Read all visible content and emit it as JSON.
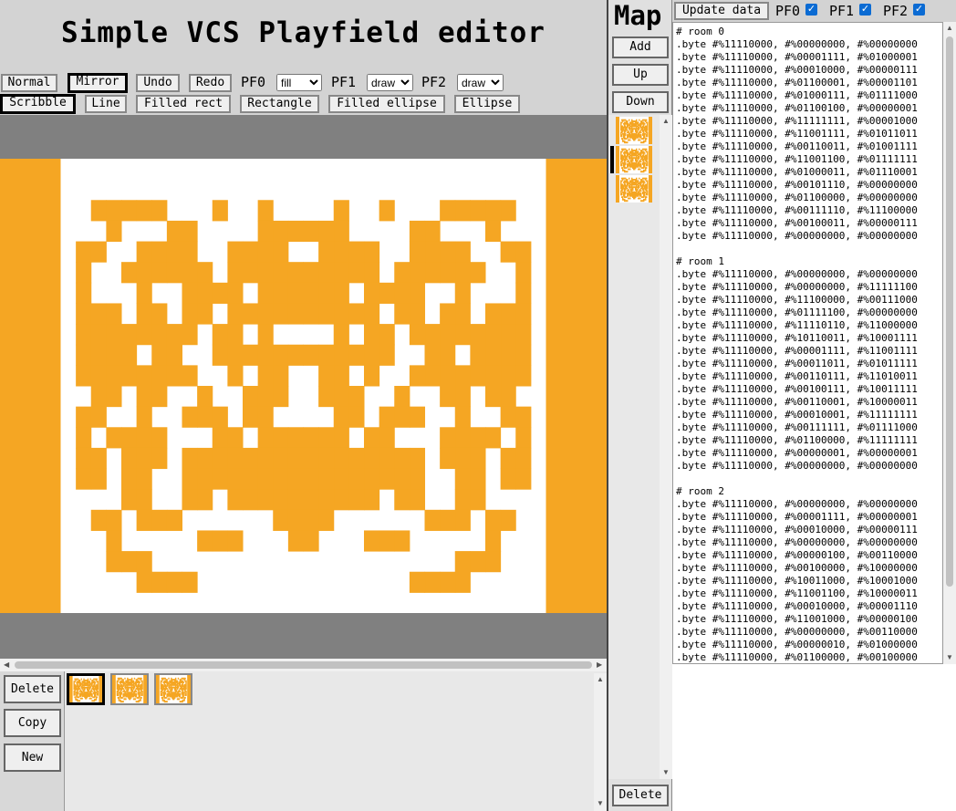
{
  "title": "Simple VCS Playfield editor",
  "colors": {
    "fg": "#f5a623",
    "bg": "#ffffff",
    "canvas_bg": "#808080"
  },
  "toolbar": {
    "normal": "Normal",
    "mirror": "Mirror",
    "undo": "Undo",
    "redo": "Redo",
    "pf0_label": "PF0",
    "pf0_value": "fill",
    "pf1_label": "PF1",
    "pf1_value": "draw",
    "pf2_label": "PF2",
    "pf2_value": "draw",
    "scribble": "Scribble",
    "line": "Line",
    "filled_rect": "Filled rect",
    "rectangle": "Rectangle",
    "filled_ellipse": "Filled ellipse",
    "ellipse": "Ellipse"
  },
  "side": {
    "delete": "Delete",
    "copy": "Copy",
    "new": "New"
  },
  "map": {
    "title": "Map",
    "add": "Add",
    "up": "Up",
    "down": "Down",
    "delete": "Delete"
  },
  "right": {
    "update": "Update data",
    "pf0": "PF0",
    "pf1": "PF1",
    "pf2": "PF2",
    "pf0_checked": true,
    "pf1_checked": true,
    "pf2_checked": true
  },
  "playfield_rows": [
    "0000000000000000",
    "0000000000000000",
    "0011111000100100",
    "0001000110000111",
    "0110011110011110",
    "0100111111011111",
    "0100010011110111",
    "0111011011011111",
    "0111111110110100",
    "0111101100111111",
    "0111111110010110",
    "0011011001001110",
    "0110010011101100",
    "0101111000110111",
    "0110111011111111",
    "0110110011111111",
    "0000110011011111",
    "0011011100000011",
    "0001000001110001",
    "0001110000000000",
    "0000011110000000",
    "0000000000000000"
  ],
  "code_lines": [
    "# room 0",
    ".byte #%11110000, #%00000000, #%00000000",
    ".byte #%11110000, #%00001111, #%01000001",
    ".byte #%11110000, #%00010000, #%00000111",
    ".byte #%11110000, #%01100001, #%00001101",
    ".byte #%11110000, #%01000111, #%01111000",
    ".byte #%11110000, #%01100100, #%00000001",
    ".byte #%11110000, #%11111111, #%00001000",
    ".byte #%11110000, #%11001111, #%01011011",
    ".byte #%11110000, #%00110011, #%01001111",
    ".byte #%11110000, #%11001100, #%01111111",
    ".byte #%11110000, #%01000011, #%01110001",
    ".byte #%11110000, #%00101110, #%00000000",
    ".byte #%11110000, #%01100000, #%00000000",
    ".byte #%11110000, #%00111110, #%11100000",
    ".byte #%11110000, #%00100011, #%00000111",
    ".byte #%11110000, #%00000000, #%00000000",
    "",
    "# room 1",
    ".byte #%11110000, #%00000000, #%00000000",
    ".byte #%11110000, #%00000000, #%11111100",
    ".byte #%11110000, #%11100000, #%00111000",
    ".byte #%11110000, #%01111100, #%00000000",
    ".byte #%11110000, #%11110110, #%11000000",
    ".byte #%11110000, #%10110011, #%10001111",
    ".byte #%11110000, #%00001111, #%11001111",
    ".byte #%11110000, #%00011011, #%01011111",
    ".byte #%11110000, #%00110111, #%11010011",
    ".byte #%11110000, #%00100111, #%10011111",
    ".byte #%11110000, #%00110001, #%10000011",
    ".byte #%11110000, #%00010001, #%11111111",
    ".byte #%11110000, #%00111111, #%01111000",
    ".byte #%11110000, #%01100000, #%11111111",
    ".byte #%11110000, #%00000001, #%00000001",
    ".byte #%11110000, #%00000000, #%00000000",
    "",
    "# room 2",
    ".byte #%11110000, #%00000000, #%00000000",
    ".byte #%11110000, #%00001111, #%00000001",
    ".byte #%11110000, #%00010000, #%00000111",
    ".byte #%11110000, #%00000000, #%00000000",
    ".byte #%11110000, #%00000100, #%00110000",
    ".byte #%11110000, #%00100000, #%10000000",
    ".byte #%11110000, #%10011000, #%10001000",
    ".byte #%11110000, #%11001100, #%10000011",
    ".byte #%11110000, #%00010000, #%00001110",
    ".byte #%11110000, #%11001000, #%00000100",
    ".byte #%11110000, #%00000000, #%00110000",
    ".byte #%11110000, #%00000010, #%01000000",
    ".byte #%11110000, #%01100000, #%00100000"
  ]
}
